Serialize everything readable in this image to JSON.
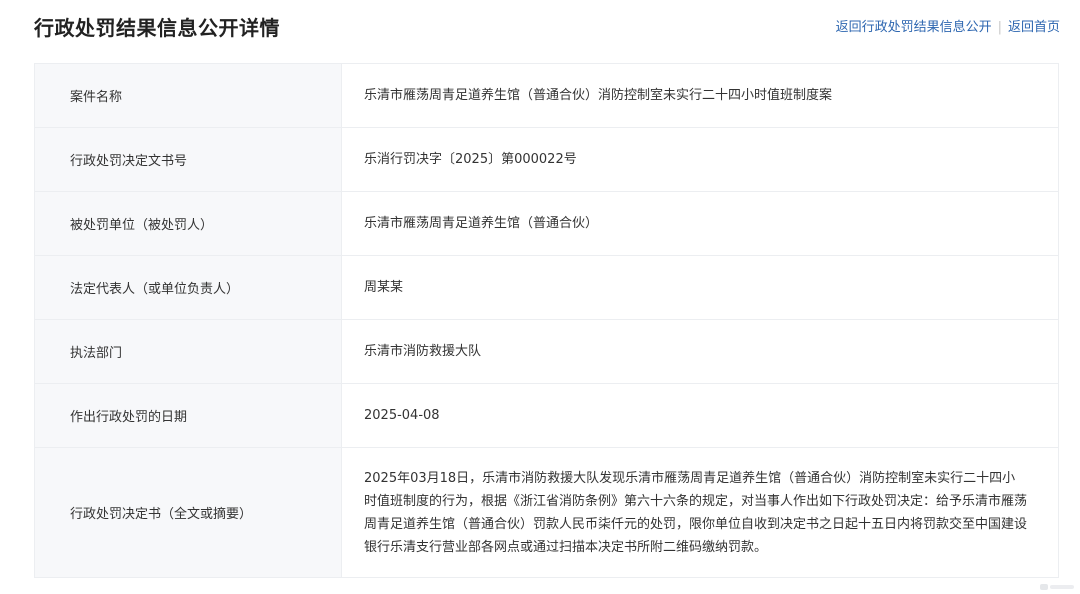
{
  "header": {
    "title": "行政处罚结果信息公开详情",
    "links": {
      "back_to_list": "返回行政处罚结果信息公开",
      "separator": "|",
      "back_home": "返回首页"
    }
  },
  "details": [
    {
      "label": "案件名称",
      "value": "乐清市雁荡周青足道养生馆（普通合伙）消防控制室未实行二十四小时值班制度案"
    },
    {
      "label": "行政处罚决定文书号",
      "value": "乐消行罚决字〔2025〕第000022号"
    },
    {
      "label": "被处罚单位（被处罚人）",
      "value": "乐清市雁荡周青足道养生馆（普通合伙）"
    },
    {
      "label": "法定代表人（或单位负责人）",
      "value": "周某某"
    },
    {
      "label": "执法部门",
      "value": "乐清市消防救援大队"
    },
    {
      "label": "作出行政处罚的日期",
      "value": "2025-04-08"
    },
    {
      "label": "行政处罚决定书（全文或摘要）",
      "value": "2025年03月18日，乐清市消防救援大队发现乐清市雁荡周青足道养生馆（普通合伙）消防控制室未实行二十四小时值班制度的行为，根据《浙江省消防条例》第六十六条的规定，对当事人作出如下行政处罚决定：给予乐清市雁荡周青足道养生馆（普通合伙）罚款人民币柒仟元的处罚，限你单位自收到决定书之日起十五日内将罚款交至中国建设银行乐清支行营业部各网点或通过扫描本决定书所附二维码缴纳罚款。"
    }
  ]
}
